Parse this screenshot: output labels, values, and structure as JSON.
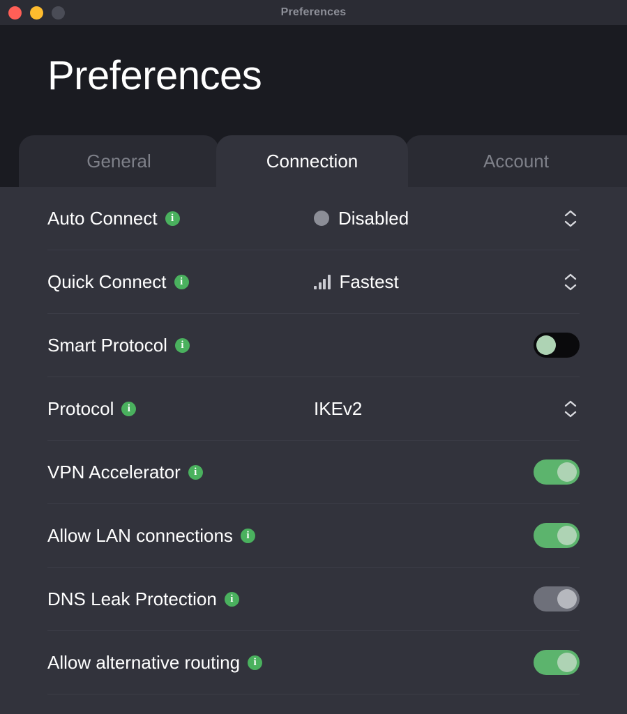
{
  "window": {
    "titlebar_title": "Preferences",
    "traffic_lights": [
      {
        "name": "close",
        "color": "#ff5f57"
      },
      {
        "name": "minimize",
        "color": "#febc2e"
      },
      {
        "name": "zoom",
        "color": "#4a4c56"
      }
    ]
  },
  "header": {
    "page_title": "Preferences"
  },
  "tabs": [
    {
      "label": "General",
      "active": false
    },
    {
      "label": "Connection",
      "active": true
    },
    {
      "label": "Account",
      "active": false
    }
  ],
  "colors": {
    "accent_green": "#5cb46d",
    "info_icon_green": "#4ab15e",
    "toggle_knob": "#aed3b4",
    "toggle_off_track": "#0a0a0c",
    "toggle_disabled_track": "#6e707a",
    "content_background": "#32333c",
    "header_background": "#1a1b21",
    "titlebar_background": "#2b2c34",
    "text_primary": "#ffffff",
    "text_muted": "#7e8089"
  },
  "settings": [
    {
      "label": "Auto Connect",
      "info": "i",
      "control": "select",
      "value": "Disabled",
      "value_icon": "status-dot-icon"
    },
    {
      "label": "Quick Connect",
      "info": "i",
      "control": "select",
      "value": "Fastest",
      "value_icon": "signal-bars-icon"
    },
    {
      "label": "Smart Protocol",
      "info": "i",
      "control": "toggle",
      "state": "off"
    },
    {
      "label": "Protocol",
      "info": "i",
      "control": "select",
      "value": "IKEv2",
      "value_icon": null
    },
    {
      "label": "VPN Accelerator",
      "info": "i",
      "control": "toggle",
      "state": "on"
    },
    {
      "label": "Allow LAN connections",
      "info": "i",
      "control": "toggle",
      "state": "on"
    },
    {
      "label": "DNS Leak Protection",
      "info": "i",
      "control": "toggle",
      "state": "disabled"
    },
    {
      "label": "Allow alternative routing",
      "info": "i",
      "control": "toggle",
      "state": "on"
    }
  ]
}
